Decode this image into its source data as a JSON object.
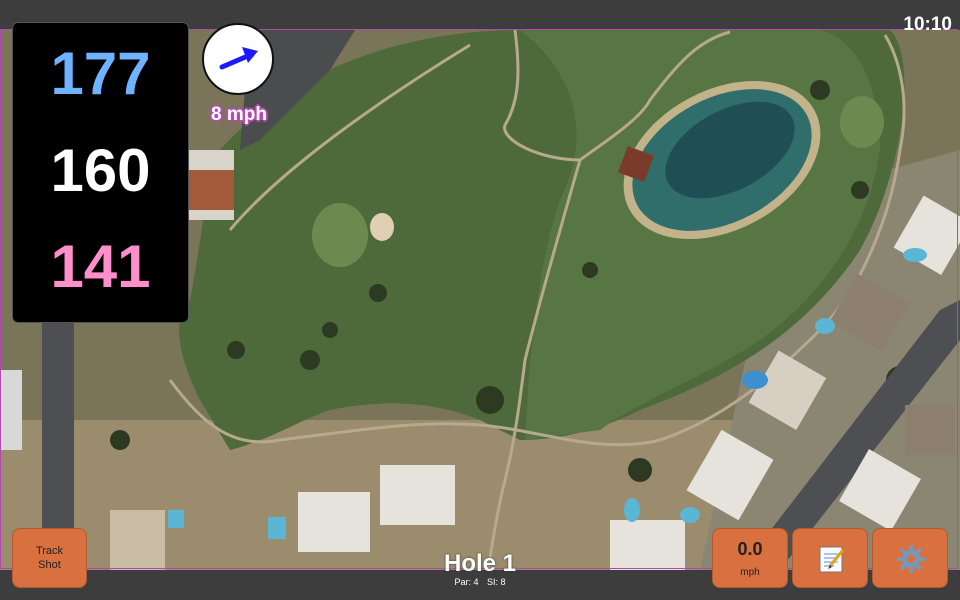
{
  "status": {
    "time": "10:10"
  },
  "distances": {
    "back": "177",
    "center": "160",
    "front": "141"
  },
  "wind": {
    "speed_label": "8 mph",
    "icon": "wind-arrow-icon"
  },
  "hole": {
    "title": "Hole 1",
    "par": "Par: 4",
    "si": "SI: 8"
  },
  "buttons": {
    "track_shot": "Track\nShot",
    "speed_value": "0.0",
    "speed_unit": "mph",
    "notes_icon": "notepad-icon",
    "settings_icon": "gear-icon"
  },
  "colors": {
    "back": "#6fb2ff",
    "center": "#ffffff",
    "front": "#ff8fcb",
    "button": "#d8703f",
    "wind_arrow": "#1a1aff",
    "border": "#b04ab0"
  }
}
